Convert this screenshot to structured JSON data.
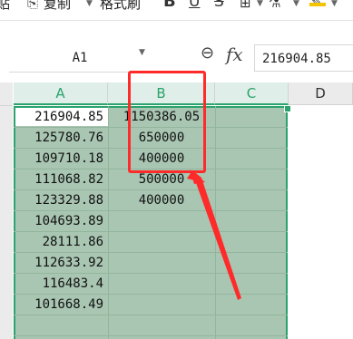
{
  "toolbar": {
    "left_fragment": "贴",
    "copy_label": "复制",
    "format_painter_label": "格式刷",
    "bold": "B",
    "underline": "U",
    "strikethrough": "S",
    "icons": [
      "clipboard-icon",
      "bold-icon",
      "underline-icon",
      "strikethrough-icon",
      "border-icon",
      "highlight-icon"
    ]
  },
  "formula_bar": {
    "name_box": "A1",
    "fx": "fx",
    "value": "216904.85"
  },
  "columns": [
    "A",
    "B",
    "C",
    "D"
  ],
  "selected_columns": [
    "A",
    "B",
    "C"
  ],
  "rows": [
    {
      "a": "216904.85",
      "b": "1150386.05"
    },
    {
      "a": "125780.76",
      "b": "650000"
    },
    {
      "a": "109710.18",
      "b": "400000"
    },
    {
      "a": "111068.82",
      "b": "500000"
    },
    {
      "a": "123329.88",
      "b": "400000"
    },
    {
      "a": "104693.89",
      "b": ""
    },
    {
      "a": "28111.86",
      "b": ""
    },
    {
      "a": "112633.92",
      "b": ""
    },
    {
      "a": "116483.4",
      "b": ""
    },
    {
      "a": "101668.49",
      "b": ""
    }
  ],
  "colors": {
    "selection_fill": "#a9c6b2",
    "selection_border": "#2aa36c",
    "annotation": "#ff2a2a"
  }
}
